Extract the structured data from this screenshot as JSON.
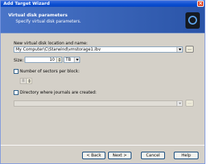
{
  "window": {
    "title": "Add Target Wizard",
    "close_label": "×"
  },
  "header": {
    "title": "Virtual disk parameters",
    "subtitle": "Specify virtual disk parameters.",
    "logo_icon": "starwind-logo-icon"
  },
  "form": {
    "location_label": "New virtual disk location and name:",
    "location_value": "My Computer\\C\\Starwind\\vmstorage1.ibv",
    "browse_label": "...",
    "size_label": "Size:",
    "size_value": "10",
    "size_unit": "TB",
    "sectors_label": "Number of sectors per block:",
    "sectors_value": "8",
    "journal_label": "Directory where journals are created:",
    "journal_value": "",
    "journal_browse_label": "..."
  },
  "buttons": {
    "back": "< Back",
    "next": "Next >",
    "cancel": "Cancel",
    "help": "Help"
  }
}
